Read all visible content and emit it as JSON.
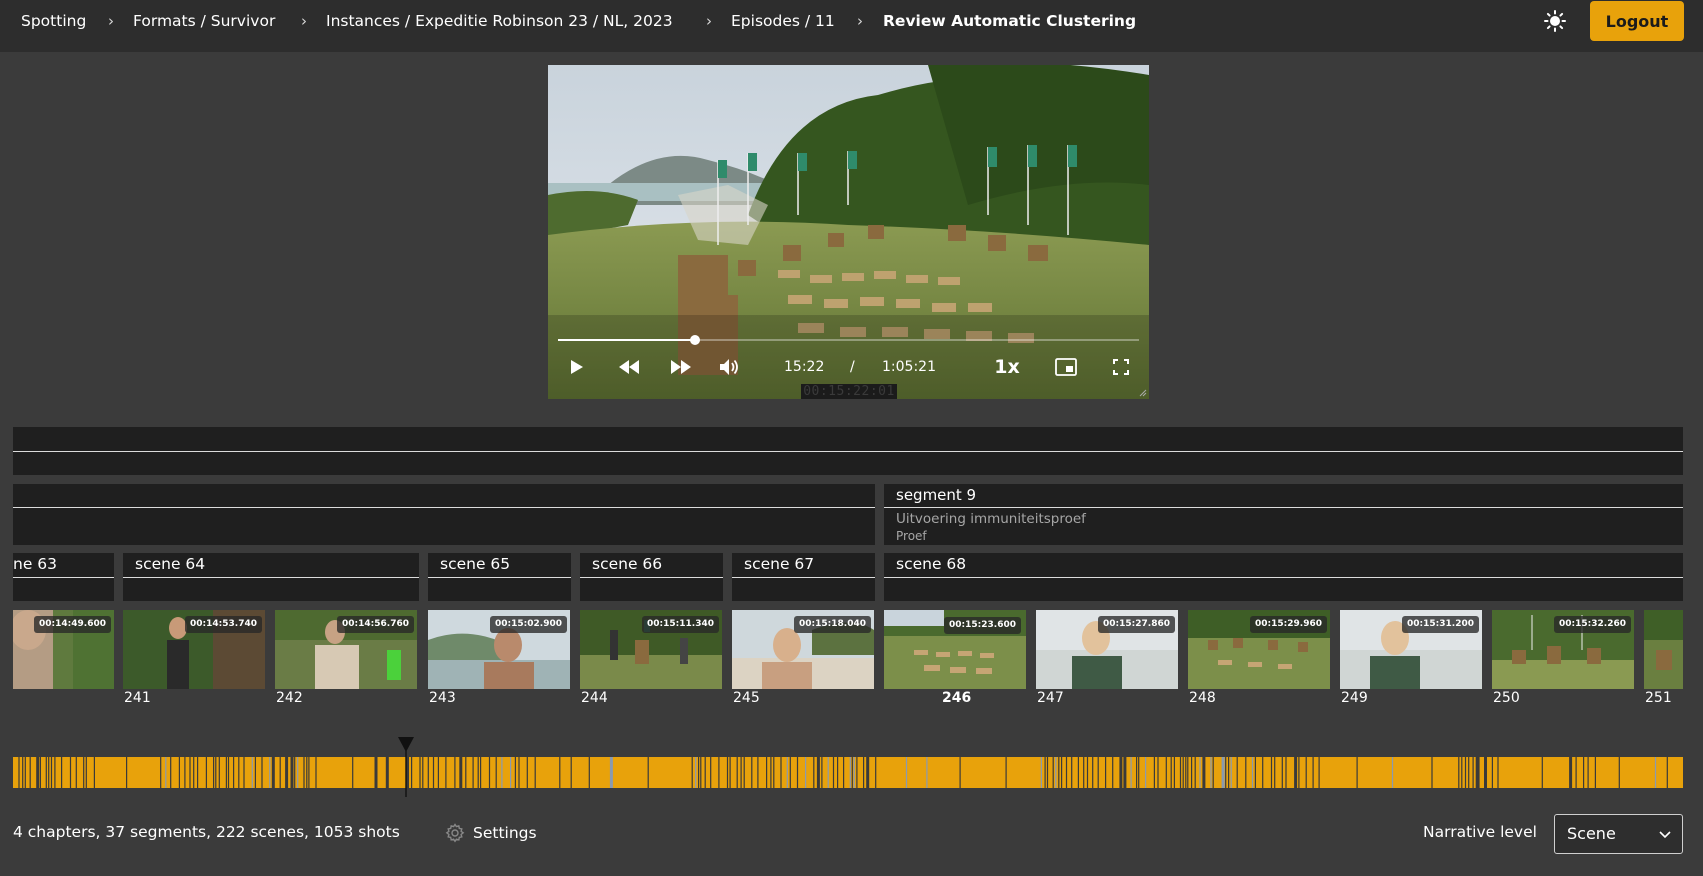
{
  "breadcrumb": {
    "items": [
      "Spotting",
      "Formats / Survivor",
      "Instances / Expeditie Robinson 23 / NL, 2023",
      "Episodes / 11",
      "Review Automatic Clustering"
    ]
  },
  "header": {
    "logout_label": "Logout",
    "theme_icon": "sun-icon"
  },
  "player": {
    "current_time": "15:22",
    "time_separator": "/",
    "duration": "1:05:21",
    "speed": "1x",
    "timecode": "00:15:22:01",
    "progress": 0.235
  },
  "segment": {
    "title": "segment 9",
    "description": "Uitvoering immuniteitsproef",
    "tag": "Proef"
  },
  "scenes": [
    "ne 63",
    "scene 64",
    "scene 65",
    "scene 66",
    "scene 67",
    "scene 68"
  ],
  "shots": [
    {
      "number": "",
      "time": "00:14:49.600"
    },
    {
      "number": "241",
      "time": "00:14:53.740"
    },
    {
      "number": "242",
      "time": "00:14:56.760"
    },
    {
      "number": "243",
      "time": "00:15:02.900"
    },
    {
      "number": "244",
      "time": "00:15:11.340"
    },
    {
      "number": "245",
      "time": "00:15:18.040"
    },
    {
      "number": "246",
      "time": "00:15:23.600",
      "active": true
    },
    {
      "number": "247",
      "time": "00:15:27.860"
    },
    {
      "number": "248",
      "time": "00:15:29.960"
    },
    {
      "number": "249",
      "time": "00:15:31.200"
    },
    {
      "number": "250",
      "time": "00:15:32.260"
    },
    {
      "number": "251",
      "time": ""
    }
  ],
  "footer": {
    "stats": "4 chapters, 37 segments, 222 scenes, 1053 shots",
    "settings_label": "Settings",
    "narrative_label": "Narrative level",
    "narrative_value": "Scene"
  },
  "colors": {
    "accent": "#e8a20b",
    "topbar": "#2d2d2d",
    "background": "#3b3b3b",
    "band": "#1f1f1f"
  }
}
